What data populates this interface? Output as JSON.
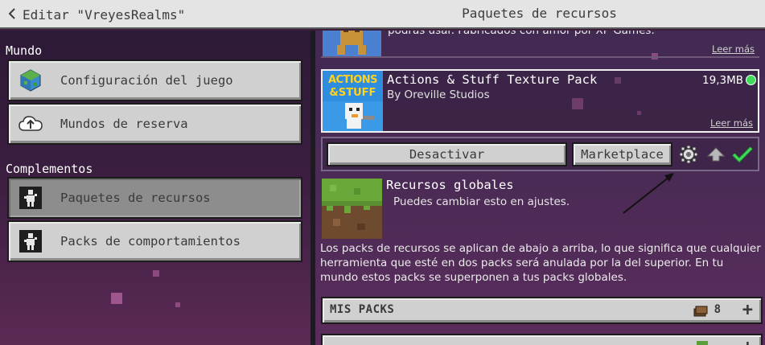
{
  "header": {
    "back_label": "Editar \"VreyesRealms\"",
    "title": "Paquetes de recursos"
  },
  "sidebar": {
    "world_label": "Mundo",
    "addons_label": "Complementos",
    "items": [
      {
        "label": "Configuración del juego",
        "icon": "globe-icon"
      },
      {
        "label": "Mundos de reserva",
        "icon": "cloud-upload-icon"
      },
      {
        "label": "Paquetes de recursos",
        "icon": "resource-pack-icon",
        "selected": true
      },
      {
        "label": "Packs de comportamientos",
        "icon": "behavior-pack-icon"
      }
    ]
  },
  "packs": {
    "top_desc": "podrás usar. Fabricados con amor por XP Games.",
    "read_more": "Leer más",
    "selected": {
      "name": "Actions & Stuff Texture Pack",
      "author": "By Oreville Studios",
      "size": "19,3MB",
      "read_more": "Leer más",
      "thumb_line1": "ACTIONS",
      "thumb_line2": "&STUFF",
      "status_color": "#3fdc5c"
    },
    "actions": {
      "deactivate": "Desactivar",
      "marketplace": "Marketplace"
    }
  },
  "global": {
    "title": "Recursos globales",
    "subtitle": "Puedes cambiar esto en ajustes.",
    "info": "Los packs de recursos se aplican de abajo a arriba, lo que significa que cualquier herramienta que esté en dos packs será anulada por la del superior. En tu mundo estos packs se superponen a tus packs globales."
  },
  "sections": [
    {
      "label": "MIS PACKS",
      "count": "8"
    }
  ],
  "colors": {
    "accent_green": "#3fdc5c",
    "button_gray": "#d0d0d0"
  }
}
